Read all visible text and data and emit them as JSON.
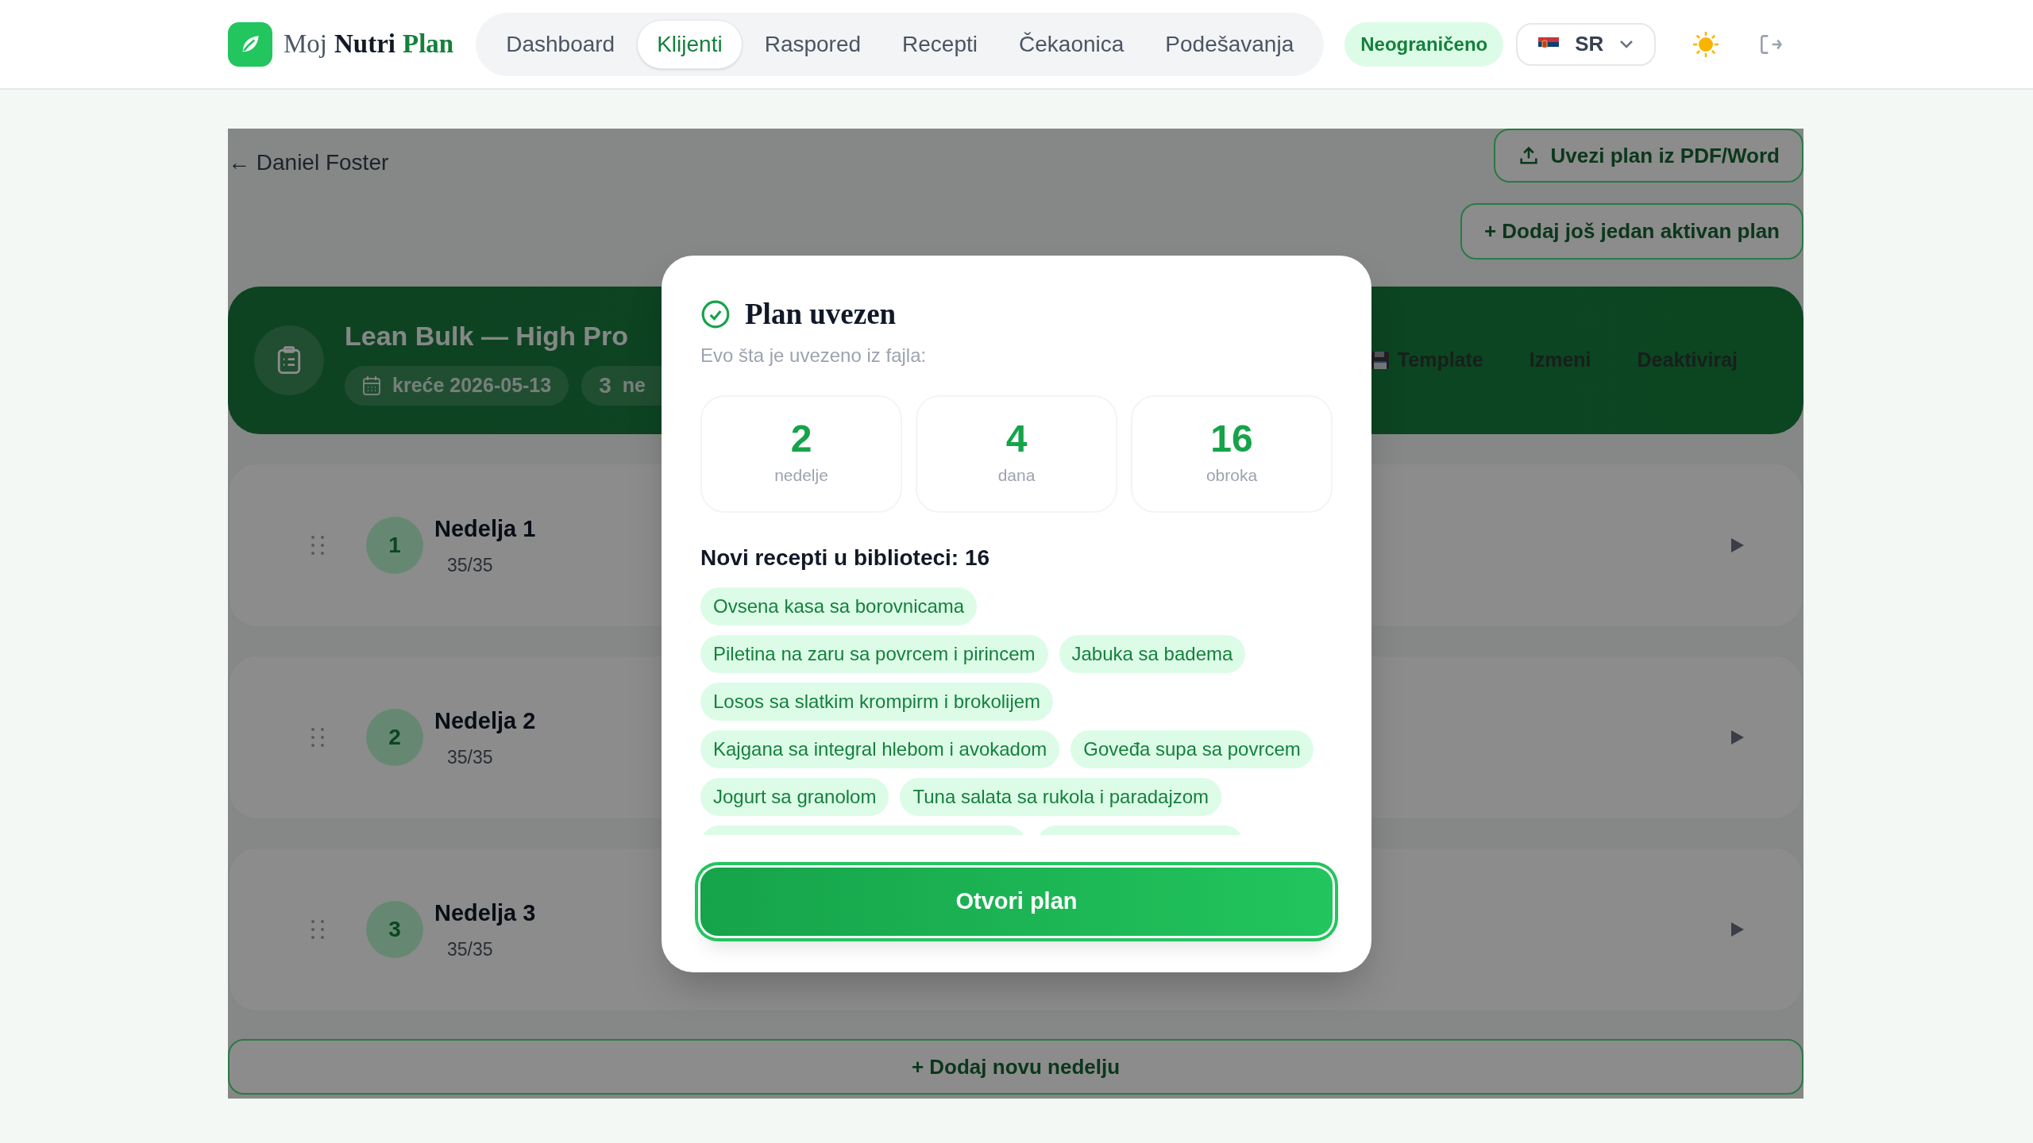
{
  "header": {
    "logo": [
      {
        "text": "Moj",
        "kind": "muted"
      },
      {
        "text": "Nutri",
        "kind": "strong"
      },
      {
        "text": "Plan",
        "kind": "accent"
      }
    ],
    "tabs": [
      {
        "label": "Dashboard",
        "selected": false
      },
      {
        "label": "Klijenti",
        "selected": true
      },
      {
        "label": "Raspored",
        "selected": false
      },
      {
        "label": "Recepti",
        "selected": false
      },
      {
        "label": "Čekaonica",
        "selected": false
      },
      {
        "label": "Podešavanja",
        "selected": false
      }
    ],
    "plan_badge": "Neograničeno",
    "language": "SR"
  },
  "page": {
    "back_link": "← Daniel Foster",
    "import_button": "Uvezi plan iz PDF/Word",
    "add_plan_button": "+ Dodaj još jedan aktivan plan",
    "plan": {
      "title": "Lean Bulk — High Pro",
      "chips": [
        {
          "kind": "date",
          "text": "kreće 2026-05-13"
        },
        {
          "kind": "count",
          "number": "3",
          "text": "ne"
        }
      ],
      "actions": [
        {
          "kind": "template",
          "label": "Template"
        },
        {
          "kind": "plain",
          "label": "Izmeni"
        },
        {
          "kind": "plain",
          "label": "Deaktiviraj"
        }
      ]
    },
    "weeks": [
      {
        "number": "1",
        "title": "Nedelja 1",
        "progress": "35/35"
      },
      {
        "number": "2",
        "title": "Nedelja 2",
        "progress": "35/35"
      },
      {
        "number": "3",
        "title": "Nedelja 3",
        "progress": "35/35"
      }
    ],
    "add_week_button": "+ Dodaj novu nedelju"
  },
  "modal": {
    "title": "Plan uvezen",
    "subtitle": "Evo šta je uvezeno iz fajla:",
    "stats": [
      {
        "value": "2",
        "label": "nedelje"
      },
      {
        "value": "4",
        "label": "dana"
      },
      {
        "value": "16",
        "label": "obroka"
      }
    ],
    "recipes_heading": "Novi recepti u biblioteci: 16",
    "recipes": [
      "Ovsena kasa sa borovnicama",
      "Piletina na zaru sa povrcem i pirincem",
      "Jabuka sa badema",
      "Losos sa slatkim krompirm i brokolijem",
      "Kajgana sa integral hlebom i avokadom",
      "Goveđa supa sa povrcem",
      "Jogurt sa granolom",
      "Tuna salata sa rukola i paradajzom"
    ],
    "primary_button": "Otvori plan"
  }
}
